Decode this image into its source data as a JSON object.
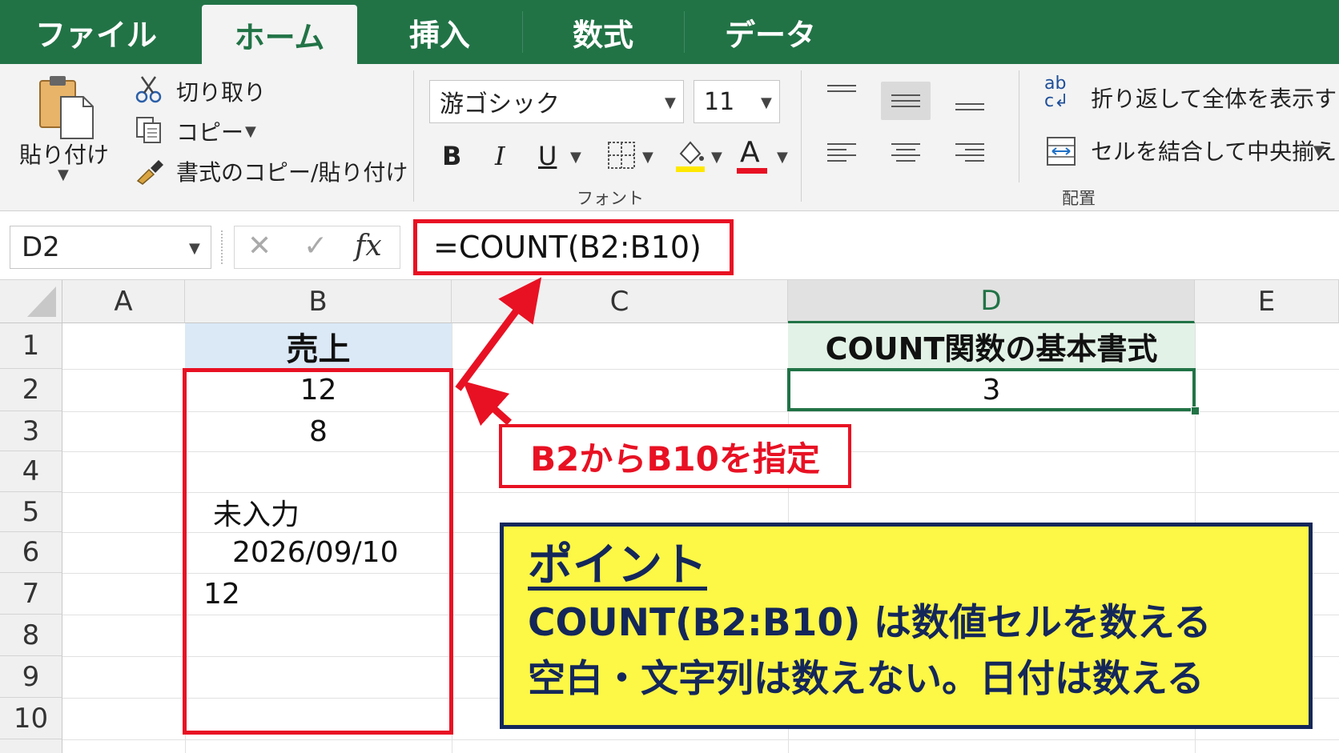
{
  "tabs": [
    "ファイル",
    "ホーム",
    "挿入",
    "数式",
    "データ"
  ],
  "active_tab": "ホーム",
  "ribbon": {
    "clipboard": {
      "paste": "貼り付け",
      "cut": "切り取り",
      "copy": "コピー",
      "format_painter": "書式のコピー/貼り付け"
    },
    "font": {
      "font_name": "游ゴシック",
      "font_size": "11",
      "bold": "B",
      "italic": "I",
      "underline": "U",
      "font_color_glyph": "A",
      "group_label": "フォント",
      "fill_color": "#FFE800",
      "font_color": "#E81123"
    },
    "alignment": {
      "wrap_icon_text": "ab",
      "wrap_text": "折り返して全体を表示する",
      "merge_center": "セルを結合して中央揃え",
      "group_label": "配置"
    }
  },
  "formula_bar": {
    "name_box": "D2",
    "fx": "fx",
    "formula": "=COUNT(B2:B10)"
  },
  "columns": [
    "A",
    "B",
    "C",
    "D",
    "E"
  ],
  "selected_column": "D",
  "rows": [
    "1",
    "2",
    "3",
    "4",
    "5",
    "6",
    "7",
    "8",
    "9",
    "10"
  ],
  "cells": {
    "B1": "売上",
    "B2": "12",
    "B3": "8",
    "B5": "未入力",
    "B6": "2026/09/10",
    "B7": "12",
    "D1": "COUNT関数の基本書式",
    "D2": "3"
  },
  "annotations": {
    "callout": "B2からB10を指定",
    "point_title": "ポイント",
    "point_line1": "COUNT(B2:B10) は数値セルを数える",
    "point_line2": "空白・文字列は数えない。日付は数える"
  },
  "colors": {
    "excel_green": "#217346",
    "highlight_red": "#E81123",
    "point_bg": "#FDF746",
    "point_border": "#14275A",
    "header_b1_bg": "#DBE9F7",
    "header_d1_bg": "#E2F2E6"
  }
}
